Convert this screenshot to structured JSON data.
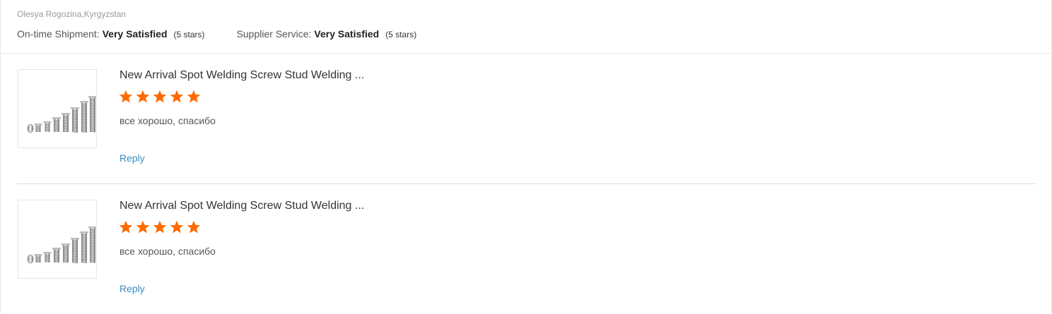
{
  "reviewer": {
    "name_location": "Olesya Rogozina,Kyrgyzstan"
  },
  "ratings": {
    "shipment_label": "On-time Shipment:",
    "shipment_value": "Very Satisfied",
    "shipment_stars": "(5 stars)",
    "service_label": "Supplier Service:",
    "service_value": "Very Satisfied",
    "service_stars": "(5 stars)"
  },
  "colors": {
    "star": "#ff6a00",
    "link": "#3b8ec3"
  },
  "items": [
    {
      "title": "New Arrival Spot Welding Screw Stud Welding ...",
      "rating": 5,
      "comment": "все хорошо, спасибо",
      "reply_label": "Reply",
      "image_icon": "welding-studs-image"
    },
    {
      "title": "New Arrival Spot Welding Screw Stud Welding ...",
      "rating": 5,
      "comment": "все хорошо, спасибо",
      "reply_label": "Reply",
      "image_icon": "welding-studs-image"
    }
  ]
}
